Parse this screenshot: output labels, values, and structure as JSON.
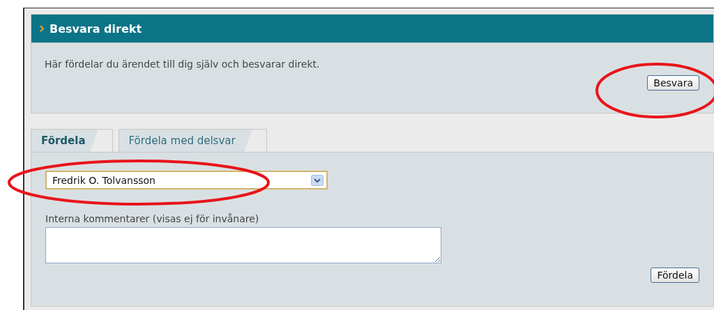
{
  "direct_panel": {
    "title": "Besvara direkt",
    "description": "Här fördelar du ärendet till dig själv och besvarar direkt.",
    "button": "Besvara"
  },
  "tabs": [
    {
      "label": "Fördela",
      "selected": true
    },
    {
      "label": "Fördela med delsvar",
      "selected": false
    }
  ],
  "assign_form": {
    "assignee": {
      "value": "Fredrik O. Tolvansson"
    },
    "comment": {
      "label": "Interna kommentarer (visas ej för invånare)"
    },
    "button": "Fördela"
  }
}
